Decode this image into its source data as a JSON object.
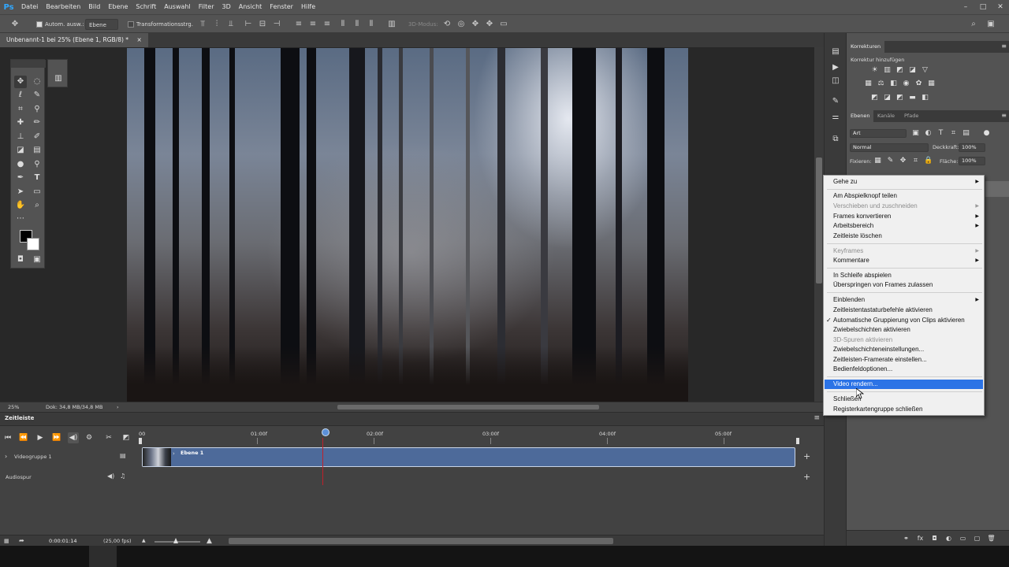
{
  "app": {
    "logo": "Ps",
    "menu": [
      "Datei",
      "Bearbeiten",
      "Bild",
      "Ebene",
      "Schrift",
      "Auswahl",
      "Filter",
      "3D",
      "Ansicht",
      "Fenster",
      "Hilfe"
    ],
    "window_controls": [
      "–",
      "□",
      "✕"
    ]
  },
  "options_bar": {
    "auto_select_label": "Autom. ausw.:",
    "auto_select_target": "Ebene",
    "transform_label": "Transformationsstrg.",
    "mode_3d": "3D-Modus:"
  },
  "document": {
    "tab_title": "Unbenannt-1 bei 25% (Ebene 1, RGB/8) *",
    "tab_close": "×",
    "zoom": "25%",
    "doc_info": "Dok: 34,8 MB/34,8 MB"
  },
  "timeline": {
    "panel_title": "Zeitleiste",
    "ruler_marks": [
      "00",
      "01:00f",
      "02:00f",
      "03:00f",
      "04:00f",
      "05:00f"
    ],
    "playhead_fraction": 0.275,
    "video_group": "Videogruppe 1",
    "clip_label": "Ebene 1",
    "audio_track": "Audiospur",
    "current_time": "0:00:01:14",
    "fps": "(25,00 fps)"
  },
  "right_panels": {
    "adjustments_tab": "Korrekturen",
    "add_adjustment": "Korrektur hinzufügen",
    "layers_tabs": [
      "Ebenen",
      "Kanäle",
      "Pfade"
    ],
    "kind_filter": "Art",
    "blend_mode": "Normal",
    "opacity_label": "Deckkraft:",
    "opacity_value": "100%",
    "lock_label": "Fixieren:",
    "fill_label": "Fläche:",
    "fill_value": "100%"
  },
  "context_menu": {
    "items": [
      {
        "label": "Gehe zu",
        "submenu": true,
        "enabled": true
      },
      {
        "label": "Am Abspielknopf teilen",
        "enabled": true
      },
      {
        "label": "Verschieben und zuschneiden",
        "submenu": true,
        "enabled": false
      },
      {
        "label": "Frames konvertieren",
        "submenu": true,
        "enabled": true
      },
      {
        "label": "Arbeitsbereich",
        "submenu": true,
        "enabled": true
      },
      {
        "label": "Zeitleiste löschen",
        "enabled": true
      },
      {
        "label": "Keyframes",
        "submenu": true,
        "enabled": false
      },
      {
        "label": "Kommentare",
        "submenu": true,
        "enabled": true
      },
      {
        "label": "In Schleife abspielen",
        "enabled": true
      },
      {
        "label": "Überspringen von Frames zulassen",
        "enabled": true
      },
      {
        "label": "Einblenden",
        "submenu": true,
        "enabled": true
      },
      {
        "label": "Zeitleistentastaturbefehle aktivieren",
        "enabled": true
      },
      {
        "label": "Automatische Gruppierung von Clips aktivieren",
        "enabled": true,
        "checked": true
      },
      {
        "label": "Zwiebelschichten aktivieren",
        "enabled": true
      },
      {
        "label": "3D-Spuren aktivieren",
        "enabled": false
      },
      {
        "label": "Zwiebelschichteneinstellungen...",
        "enabled": true
      },
      {
        "label": "Zeitleisten-Framerate einstellen...",
        "enabled": true
      },
      {
        "label": "Bedienfeldoptionen...",
        "enabled": true
      },
      {
        "label": "Video rendern...",
        "enabled": true,
        "highlighted": true
      },
      {
        "label": "Schließen",
        "enabled": true
      },
      {
        "label": "Registerkartengruppe schließen",
        "enabled": true
      }
    ]
  },
  "colors": {
    "accent": "#2b73e6",
    "clip": "#4d6a9a",
    "playhead_line": "#c0202a",
    "ps_blue": "#31a8ff"
  }
}
